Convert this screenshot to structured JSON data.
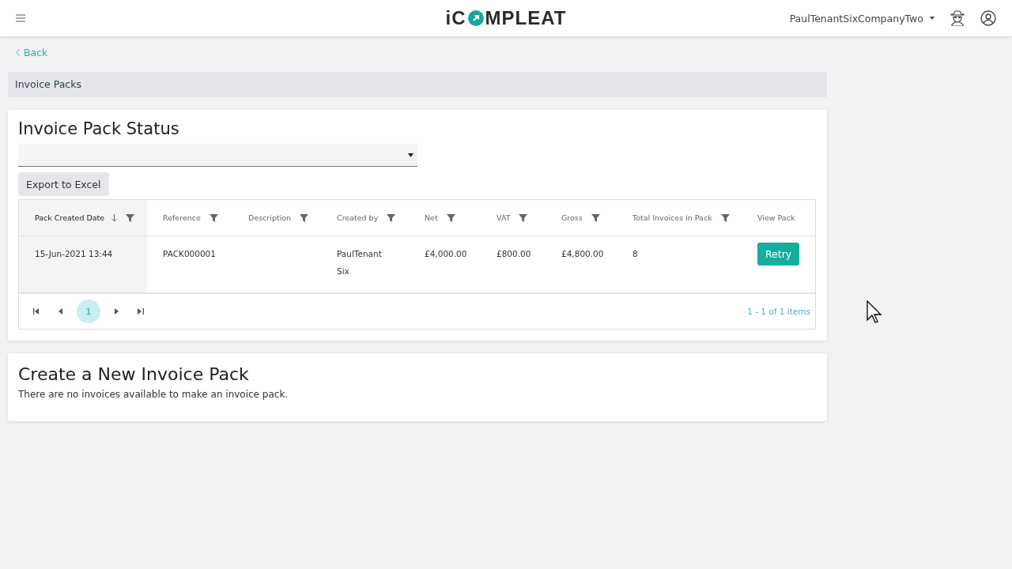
{
  "header": {
    "logo": {
      "left": "iC",
      "right": "MPLEAT"
    },
    "user": "PaulTenantSixCompanyTwo"
  },
  "back_link": "Back",
  "breadcrumb": "Invoice Packs",
  "status_panel": {
    "title": "Invoice Pack Status",
    "export_button": "Export to Excel",
    "table": {
      "columns": [
        {
          "label": "Pack Created Date",
          "sorted": true,
          "filterable": true
        },
        {
          "label": "Reference",
          "sorted": false,
          "filterable": true
        },
        {
          "label": "Description",
          "sorted": false,
          "filterable": true
        },
        {
          "label": "Created by",
          "sorted": false,
          "filterable": true
        },
        {
          "label": "Net",
          "sorted": false,
          "filterable": true
        },
        {
          "label": "VAT",
          "sorted": false,
          "filterable": true
        },
        {
          "label": "Gross",
          "sorted": false,
          "filterable": true
        },
        {
          "label": "Total Invoices in Pack",
          "sorted": false,
          "filterable": true
        },
        {
          "label": "View Pack",
          "sorted": false,
          "filterable": false
        }
      ],
      "rows": [
        {
          "cells": [
            "15-Jun-2021 13:44",
            "PACK000001",
            "",
            "PaulTenant Six",
            "£4,000.00",
            "£800.00",
            "£4,800.00",
            "8"
          ],
          "action": "Retry"
        }
      ]
    },
    "pager": {
      "pages": [
        {
          "label": "1",
          "selected": true
        }
      ],
      "summary": "1 - 1 of 1 items"
    }
  },
  "create_panel": {
    "title": "Create a New Invoice Pack",
    "message": "There are no invoices available to make an invoice pack."
  }
}
